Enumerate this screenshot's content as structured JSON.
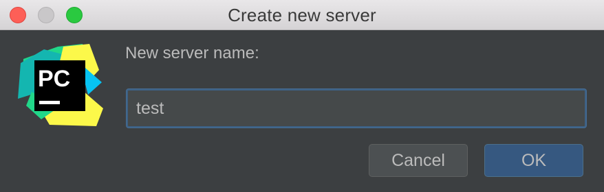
{
  "window": {
    "title": "Create new server"
  },
  "logo": {
    "text": "PC",
    "icon": "pycharm-logo-icon"
  },
  "form": {
    "label": "New server name:",
    "name_value": "test"
  },
  "buttons": {
    "cancel_label": "Cancel",
    "ok_label": "OK"
  },
  "colors": {
    "background": "#3c3f41",
    "input_border": "#3d6185",
    "ok_button": "#365880",
    "cancel_button": "#4c5052"
  }
}
